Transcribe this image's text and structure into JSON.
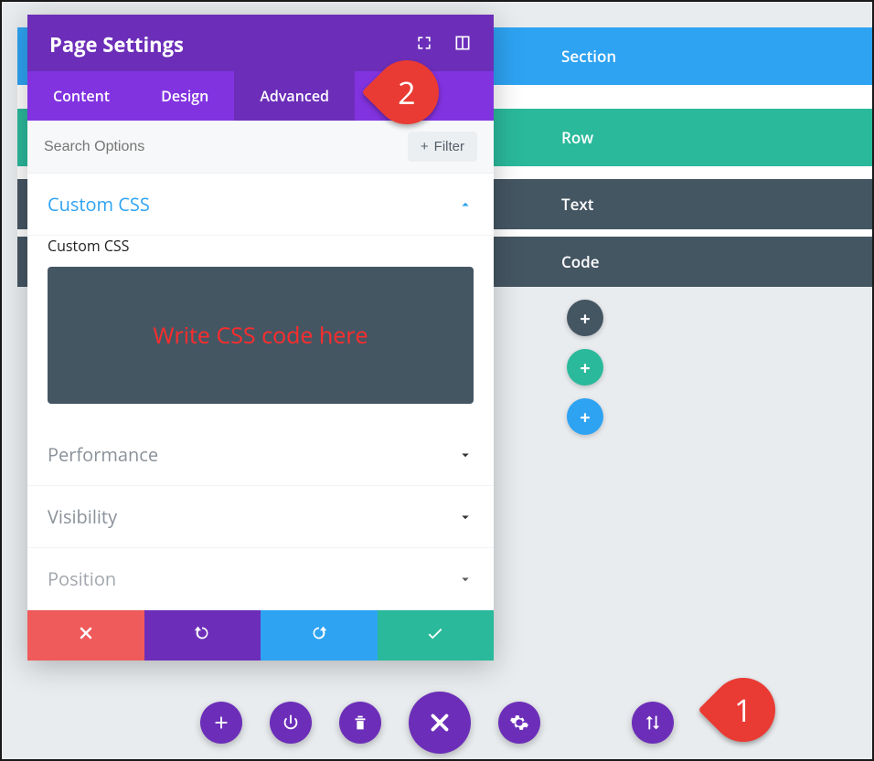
{
  "page": {
    "structure": {
      "section": "Section",
      "row": "Row",
      "text": "Text",
      "code": "Code"
    },
    "add_glyph": "+"
  },
  "modal": {
    "title": "Page Settings",
    "tabs": {
      "content": "Content",
      "design": "Design",
      "advanced": "Advanced"
    },
    "search_placeholder": "Search Options",
    "filter_label": "Filter",
    "sections": {
      "custom_css": "Custom CSS",
      "custom_css_label": "Custom CSS",
      "css_editor_hint": "Write CSS code here",
      "performance": "Performance",
      "visibility": "Visibility",
      "position": "Position"
    }
  },
  "callouts": {
    "pin1": "1",
    "pin2": "2"
  }
}
